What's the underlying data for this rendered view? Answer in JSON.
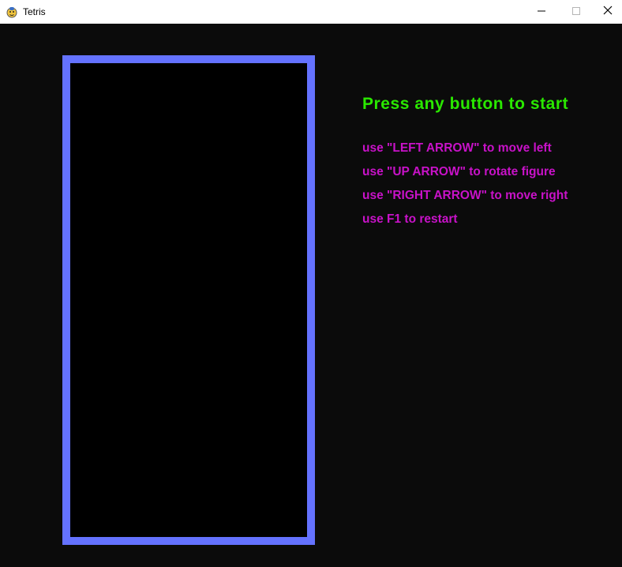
{
  "window": {
    "title": "Tetris",
    "icon": "pygame-snake-icon",
    "controls": {
      "minimize_icon": "minimize-icon",
      "maximize_icon": "maximize-icon",
      "close_icon": "close-icon"
    }
  },
  "game": {
    "board_border_color": "#6472ff",
    "board_fill_color": "#000000",
    "background_color": "#0b0b0b",
    "headline": "Press any button to start",
    "headline_color": "#2ae800",
    "instructions_color": "#c812c8",
    "instructions": [
      "use \"LEFT ARROW\" to move left",
      "use \"UP ARROW\" to rotate figure",
      "use \"RIGHT ARROW\" to move right",
      "use F1 to restart"
    ]
  }
}
